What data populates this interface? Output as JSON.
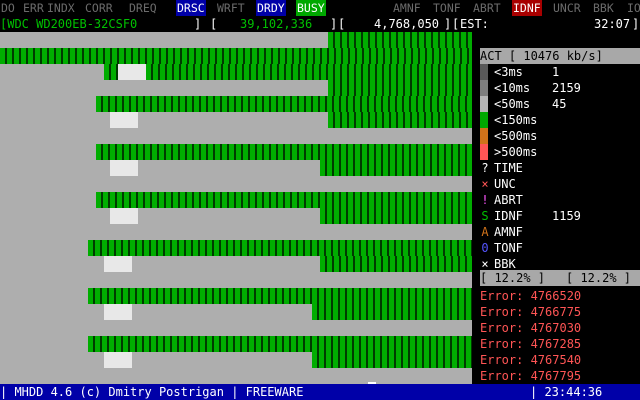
{
  "status_flags": [
    {
      "label": "DO",
      "state": "off"
    },
    {
      "label": "ERR",
      "state": "off"
    },
    {
      "label": "INDX",
      "state": "off"
    },
    {
      "label": "CORR",
      "state": "off"
    },
    {
      "label": "DREQ",
      "state": "off"
    },
    {
      "label": "DRSC",
      "state": "on-blue"
    },
    {
      "label": "WRFT",
      "state": "off"
    },
    {
      "label": "DRDY",
      "state": "on-blue"
    },
    {
      "label": "BUSY",
      "state": "on-green"
    },
    {
      "label": "AMNF",
      "state": "off"
    },
    {
      "label": "TONF",
      "state": "off"
    },
    {
      "label": "ABRT",
      "state": "off"
    },
    {
      "label": "IDNF",
      "state": "on-red"
    },
    {
      "label": "UNCR",
      "state": "off"
    },
    {
      "label": "BBK",
      "state": "off"
    },
    {
      "label": "IO",
      "state": "off"
    }
  ],
  "info": {
    "drive_model": "[WDC WD200EB-32CSF0",
    "drive_close": "]",
    "lba_open": "[",
    "current_lba": "39,102,336",
    "lba_close": "]",
    "total_open": "[",
    "total_lba": "4,768,050",
    "total_close": "]",
    "est_open": "[",
    "est_label": "EST:",
    "est_value": "32:07",
    "est_close": "]"
  },
  "panel": {
    "act_header": "ACT [ 10476 kb/s]",
    "timing_legend": [
      {
        "label": "<3ms",
        "count": "1",
        "color": "#5a5a5a"
      },
      {
        "label": "<10ms",
        "count": "2159",
        "color": "#7e7e7e"
      },
      {
        "label": "<50ms",
        "count": "45",
        "color": "#b5b5b5"
      },
      {
        "label": "<150ms",
        "count": "",
        "color": "#00a800"
      },
      {
        "label": "<500ms",
        "count": "",
        "color": "#d0721a"
      },
      {
        "label": ">500ms",
        "count": "",
        "color": "#ff5555"
      }
    ],
    "error_types": [
      {
        "symbol": "?",
        "label": "TIME",
        "count": "",
        "color": "#ffffff"
      },
      {
        "symbol": "×",
        "label": "UNC",
        "count": "",
        "color": "#ff5555"
      },
      {
        "symbol": "!",
        "label": "ABRT",
        "count": "",
        "color": "#ff55ff"
      },
      {
        "symbol": "S",
        "label": "IDNF",
        "count": "1159",
        "color": "#00c000"
      },
      {
        "symbol": "A",
        "label": "AMNF",
        "count": "",
        "color": "#d0721a"
      },
      {
        "symbol": "0",
        "label": "TONF",
        "count": "",
        "color": "#5555ff"
      },
      {
        "symbol": "×",
        "label": "BBK",
        "count": "",
        "color": "#ffffff"
      }
    ],
    "progress_left": "[ 12.2% ]",
    "progress_right": "[ 12.2% ]",
    "progress_percent": 12.2,
    "error_log": [
      "Error: 4766520",
      "Error: 4766775",
      "Error: 4767030",
      "Error: 4767285",
      "Error: 4767540",
      "Error: 4767795"
    ]
  },
  "footer": {
    "left": "| MHDD 4.6 (c) Dmitry Postrigan | FREEWARE",
    "right": "| 23:44:36"
  }
}
